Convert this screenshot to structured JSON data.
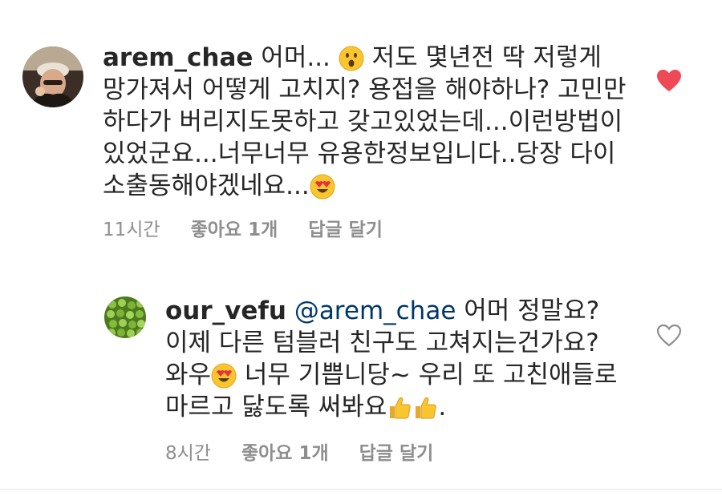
{
  "comments": [
    {
      "username": "arem_chae",
      "text_segments": [
        "어머... ",
        " 저도 몇년전 딱 저렇게 망가져서 어떻게 고치지? 용접을 해야하나? 고민만하다가 버리지도못하고 갖고있었는데...이런방법이있었군요...너무너무 유용한정보입니다..당장 다이소출동해야겠네요..."
      ],
      "emojis": [
        "surprised-face-icon",
        "heart-eyes-icon"
      ],
      "time": "11시간",
      "likes": "좋아요 1개",
      "reply_label": "답글 달기",
      "liked": true,
      "heart_color": "#ed4956"
    },
    {
      "username": "our_vefu",
      "mention": "@arem_chae",
      "text_segments": [
        " 어머 정말요? 이제 다른 텀블러 친구도 고쳐지는건가요? 와우",
        " 너무 기쁩니당~ 우리 또 고친애들로 마르고 닳도록 써봐요",
        "."
      ],
      "emojis": [
        "heart-eyes-icon",
        "thumbs-up-icon",
        "thumbs-up-icon"
      ],
      "time": "8시간",
      "likes": "좋아요 1개",
      "reply_label": "답글 달기",
      "liked": false
    }
  ]
}
